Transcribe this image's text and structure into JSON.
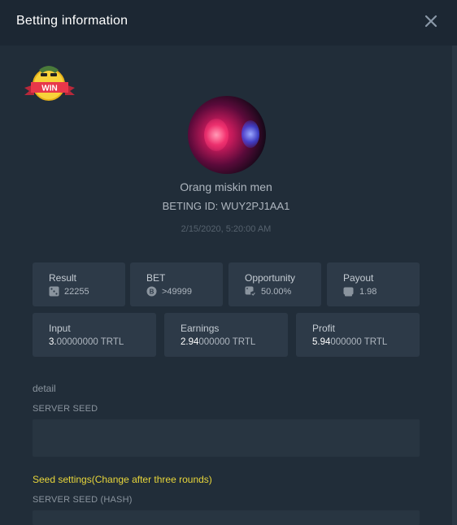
{
  "header": {
    "title": "Betting information"
  },
  "badge": {
    "text": "WIN"
  },
  "user": {
    "name": "Orang miskin men",
    "bet_id": "BETING ID: WUY2PJ1AA1",
    "timestamp": "2/15/2020, 5:20:00 AM"
  },
  "stats": {
    "result": {
      "label": "Result",
      "value": "22255",
      "icon": "dice-icon"
    },
    "bet": {
      "label": "BET",
      "value": ">49999",
      "icon": "coin-icon"
    },
    "opportunity": {
      "label": "Opportunity",
      "value": "50.00%",
      "icon": "chance-icon"
    },
    "payout": {
      "label": "Payout",
      "value": "1.98",
      "icon": "wallet-icon"
    },
    "input": {
      "label": "Input",
      "value_main": "3.",
      "value_rest": "00000000 TRTL"
    },
    "earnings": {
      "label": "Earnings",
      "value_main": "2.94",
      "value_rest": "000000 TRTL"
    },
    "profit": {
      "label": "Profit",
      "value_main": "5.94",
      "value_rest": "000000 TRTL"
    }
  },
  "detail": {
    "label": "detail",
    "server_seed_label": "SERVER SEED",
    "server_seed_value": "",
    "seed_note": "Seed settings(Change after three rounds)",
    "server_seed_hash_label": "SERVER SEED (HASH)",
    "server_seed_hash_value": ""
  },
  "colors": {
    "background": "#212d39",
    "card": "#2d3a48",
    "field": "#283541",
    "note": "#e8d63a"
  }
}
